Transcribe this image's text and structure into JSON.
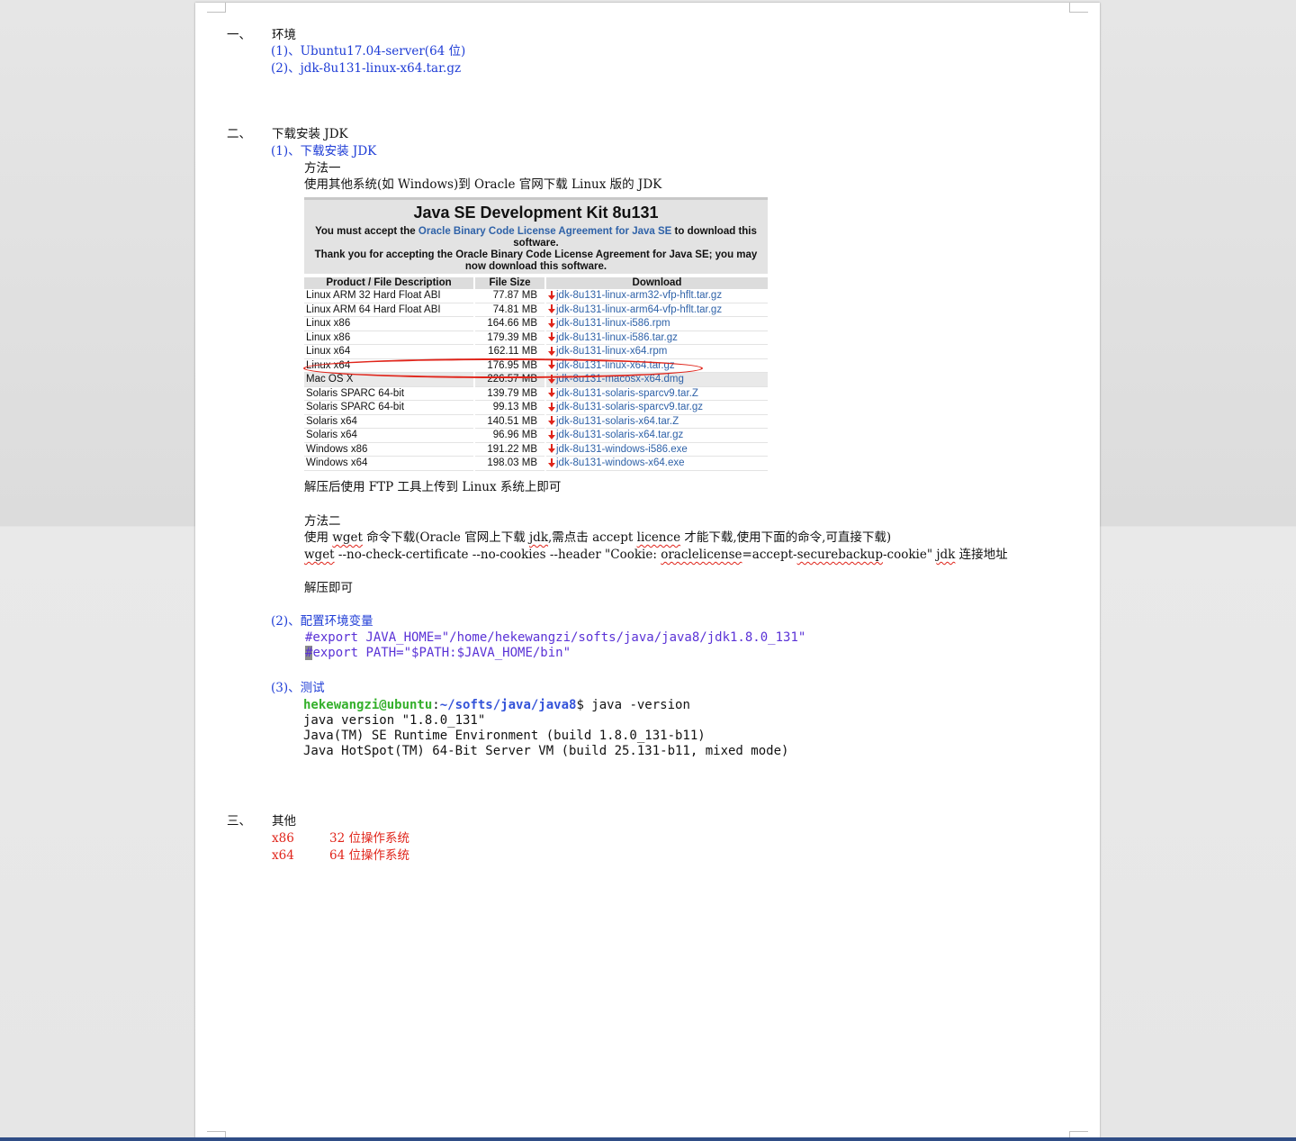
{
  "sections": {
    "s1": {
      "num": "一、",
      "title": "环境",
      "items": [
        "(1)、Ubuntu17.04-server(64 位)",
        "(2)、jdk-8u131-linux-x64.tar.gz"
      ]
    },
    "s2": {
      "num": "二、",
      "title": "下载安装 JDK",
      "sub1": "(1)、下载安装 JDK",
      "m1_title": "方法一",
      "m1_desc": "使用其他系统(如 Windows)到 Oracle 官网下载 Linux 版的 JDK",
      "m1_after": "解压后使用 FTP 工具上传到 Linux 系统上即可",
      "m2_title": "方法二",
      "m2_desc_a": "使用 ",
      "m2_desc_wget": "wget",
      "m2_desc_b": " 命令下载(Oracle 官网上下载 ",
      "m2_desc_jdk": "jdk",
      "m2_desc_c": ",需点击 accept ",
      "m2_desc_licence": "licence",
      "m2_desc_d": " 才能下载,使用下面的命令,可直接下载)",
      "cmd_wget": "wget",
      "cmd_a": " --no-check-certificate --no-cookies --header \"Cookie: ",
      "cmd_oracle": "oraclelicense",
      "cmd_b": "=accept-",
      "cmd_secure": "securebackup",
      "cmd_c": "-cookie\"  ",
      "cmd_jdk": "jdk",
      "cmd_d": " 连接地址",
      "m2_after": "解压即可",
      "sub2": "(2)、配置环境变量",
      "env_line1": "#export JAVA_HOME=\"/home/hekewangzi/softs/java/java8/jdk1.8.0_131\"",
      "env_line2_cursor": "#",
      "env_line2_rest": "export PATH=\"$PATH:$JAVA_HOME/bin\"",
      "sub3": "(3)、测试",
      "term_user": "hekewangzi@ubuntu",
      "term_colon": ":",
      "term_path": "~/softs/java/java8",
      "term_cmd": "$ java -version",
      "term_out1": "java version \"1.8.0_131\"",
      "term_out2": "Java(TM) SE Runtime Environment (build 1.8.0_131-b11)",
      "term_out3": "Java HotSpot(TM) 64-Bit Server VM (build 25.131-b11, mixed mode)"
    },
    "s3": {
      "num": "三、",
      "title": "其他",
      "rows": [
        {
          "arch": "x86",
          "desc": "32 位操作系统"
        },
        {
          "arch": "x64",
          "desc": "64 位操作系统"
        }
      ]
    }
  },
  "jdk_download": {
    "title": "Java SE Development Kit 8u131",
    "msg1_a": "You must accept the ",
    "msg1_link": "Oracle Binary Code License Agreement for Java SE",
    "msg1_b": " to download this software.",
    "msg2": "Thank you for accepting the Oracle Binary Code License Agreement for Java SE; you may now download this software.",
    "columns": [
      "Product / File Description",
      "File Size",
      "Download"
    ],
    "rows": [
      {
        "product": "Linux ARM 32 Hard Float ABI",
        "size": "77.87 MB",
        "file": "jdk-8u131-linux-arm32-vfp-hflt.tar.gz"
      },
      {
        "product": "Linux ARM 64 Hard Float ABI",
        "size": "74.81 MB",
        "file": "jdk-8u131-linux-arm64-vfp-hflt.tar.gz"
      },
      {
        "product": "Linux x86",
        "size": "164.66 MB",
        "file": "jdk-8u131-linux-i586.rpm"
      },
      {
        "product": "Linux x86",
        "size": "179.39 MB",
        "file": "jdk-8u131-linux-i586.tar.gz"
      },
      {
        "product": "Linux x64",
        "size": "162.11 MB",
        "file": "jdk-8u131-linux-x64.rpm"
      },
      {
        "product": "Linux x64",
        "size": "176.95 MB",
        "file": "jdk-8u131-linux-x64.tar.gz"
      },
      {
        "product": "Mac OS X",
        "size": "226.57 MB",
        "file": "jdk-8u131-macosx-x64.dmg"
      },
      {
        "product": "Solaris SPARC 64-bit",
        "size": "139.79 MB",
        "file": "jdk-8u131-solaris-sparcv9.tar.Z"
      },
      {
        "product": "Solaris SPARC 64-bit",
        "size": "99.13 MB",
        "file": "jdk-8u131-solaris-sparcv9.tar.gz"
      },
      {
        "product": "Solaris x64",
        "size": "140.51 MB",
        "file": "jdk-8u131-solaris-x64.tar.Z"
      },
      {
        "product": "Solaris x64",
        "size": "96.96 MB",
        "file": "jdk-8u131-solaris-x64.tar.gz"
      },
      {
        "product": "Windows x86",
        "size": "191.22 MB",
        "file": "jdk-8u131-windows-i586.exe"
      },
      {
        "product": "Windows x64",
        "size": "198.03 MB",
        "file": "jdk-8u131-windows-x64.exe"
      }
    ],
    "highlighted_row": 5,
    "shaded_row": 6
  },
  "colors": {
    "heading_blue": "#1f3dd6",
    "accent_red": "#e0241a",
    "link_blue": "#2f62a8",
    "terminal_green": "#35b02c",
    "terminal_purple": "#5a32d6"
  }
}
